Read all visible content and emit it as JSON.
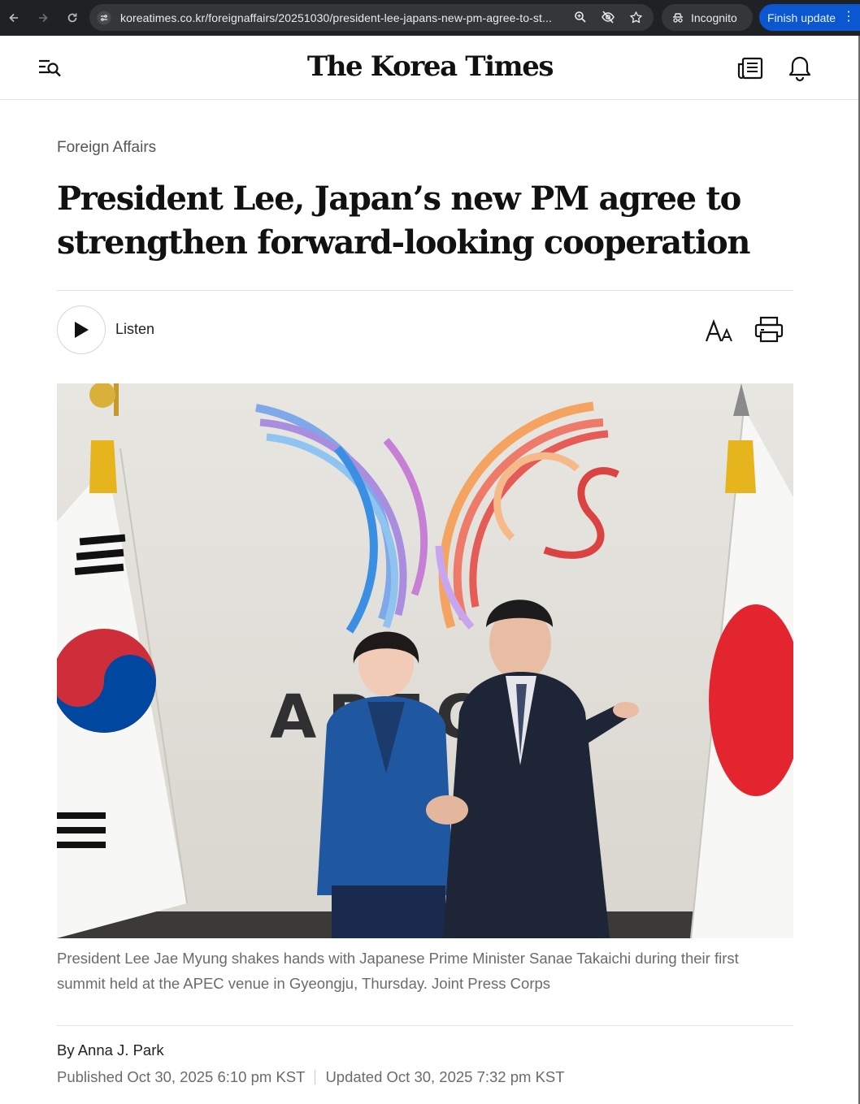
{
  "browser": {
    "url": "koreatimes.co.kr/foreignaffairs/20251030/president-lee-japans-new-pm-agree-to-st...",
    "incognito_label": "Incognito",
    "update_label": "Finish update"
  },
  "header": {
    "logo": "The Korea Times"
  },
  "article": {
    "section": "Foreign Affairs",
    "headline": "President Lee, Japan’s new PM agree to strengthen forward-looking cooperation",
    "listen_label": "Listen",
    "photo_text": "APEC 2",
    "caption": "President Lee Jae Myung shakes hands with Japanese Prime Minister Sanae Takaichi during their first summit held at the APEC venue in Gyeongju, Thursday. Joint Press Corps",
    "byline": "By Anna J. Park",
    "published": "Published Oct 30, 2025 6:10 pm KST",
    "updated": "Updated Oct 30, 2025 7:32 pm KST"
  },
  "icons": {
    "back": "arrow-left-icon",
    "forward": "arrow-right-icon",
    "reload": "reload-icon",
    "site_info": "tune-icon",
    "zoom": "zoom-icon",
    "eye_off": "eye-off-icon",
    "bookmark": "star-icon",
    "menu_search": "menu-search-icon",
    "news": "newspaper-icon",
    "bell": "bell-icon",
    "play": "play-icon",
    "font_size": "font-size-icon",
    "print": "printer-icon"
  },
  "colors": {
    "chrome_bg": "#202124",
    "omnibox_bg": "#35363a",
    "update_blue": "#0b57d0",
    "text_primary": "#111111",
    "text_muted": "#6b6b6b"
  }
}
